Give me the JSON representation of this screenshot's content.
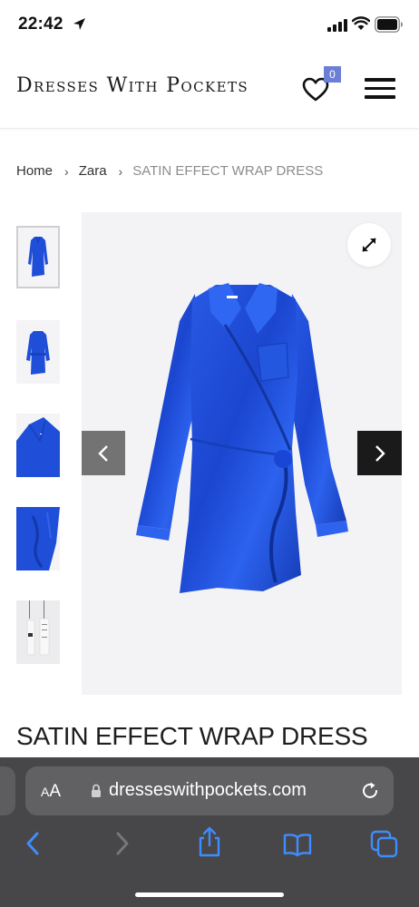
{
  "status_bar": {
    "time": "22:42",
    "icons": [
      "location-arrow-icon",
      "signal-icon",
      "wifi-icon",
      "battery-icon"
    ]
  },
  "header": {
    "logo": "Dresses With Pockets",
    "wishlist_count": "0",
    "icons": [
      "heart-icon",
      "hamburger-menu-icon"
    ],
    "badge_color": "#6b7fd7"
  },
  "breadcrumb": {
    "items": [
      "Home",
      "Zara"
    ],
    "current": "SATIN EFFECT WRAP DRESS"
  },
  "gallery": {
    "thumbnail_count": 5,
    "active_index": 0,
    "controls": [
      "expand-icon",
      "chevron-left-icon",
      "chevron-right-icon"
    ],
    "dress_color": "#1f4ed8"
  },
  "product": {
    "title": "SATIN EFFECT WRAP DRESS"
  },
  "browser": {
    "text_size_small": "A",
    "text_size_large": "A",
    "url": "dresseswithpockets.com",
    "toolbar": [
      "back-icon",
      "forward-icon",
      "share-icon",
      "bookmarks-icon",
      "tabs-icon"
    ],
    "accent": "#3f8cff"
  }
}
